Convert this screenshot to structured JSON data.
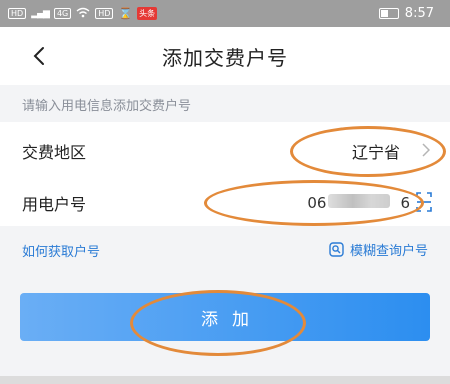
{
  "status_bar": {
    "left_items": [
      "HD",
      "4G",
      "HD",
      "头条"
    ],
    "time": "8:57"
  },
  "nav": {
    "title": "添加交费户号"
  },
  "hint": "请输入用电信息添加交费户号",
  "region_row": {
    "label": "交费地区",
    "value": "辽宁省"
  },
  "account_row": {
    "label": "用电户号",
    "value_start": "06",
    "value_end": "6"
  },
  "links": {
    "left": "如何获取户号",
    "right": "模糊查询户号"
  },
  "add_button": {
    "label": "添加"
  },
  "colors": {
    "accent": "#2a7bd5",
    "annotation": "#e38a3a",
    "button_start": "#6aaef5",
    "button_end": "#2c8ef0"
  }
}
